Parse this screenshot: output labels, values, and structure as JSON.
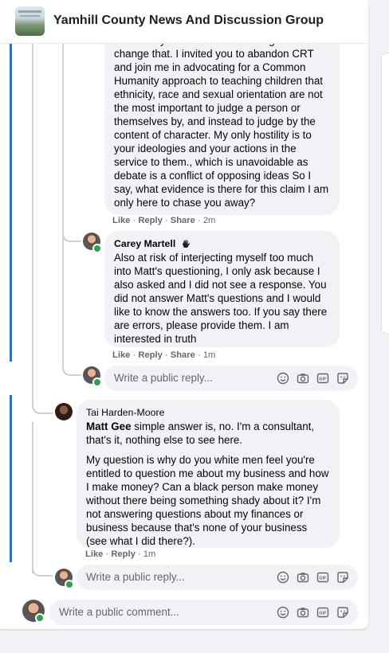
{
  "header": {
    "group_name": "Yamhill County News And Discussion Group"
  },
  "comment1": {
    "lines": [
      "community and no one has the right to",
      "change that. I invited you to abandon CRT",
      "and join me in advocating for a Common",
      "Humanity approach to teaching children that",
      "ethnicity, race and sexual orientation are not",
      "the most important to judge a person or",
      "themselves by, and instead to judge by the",
      "content of character. My only hostility is to",
      "your ideologies and your actions in the",
      "service to them., which is unavoidable as",
      "debate is a conflict of opposing ideas So I",
      "say, what evidence is there for this claim I am",
      "only here to chase you away?"
    ],
    "actions": {
      "like": "Like",
      "reply": "Reply",
      "share": "Share",
      "time": "2m"
    }
  },
  "comment2": {
    "author": "Carey Martell",
    "text": "Also at risk of interjecting myself too much into Matt's questioning, I only ask because I also asked and I did not see a response. You did not answer Matt's questions and I would like to know the answers too. If you say there are errors, please provide them. I am interested in truth",
    "actions": {
      "like": "Like",
      "reply": "Reply",
      "share": "Share",
      "time": "1m"
    }
  },
  "reply_box_1": {
    "placeholder": "Write a public reply..."
  },
  "comment3": {
    "author": "Tai Harden-Moore",
    "mention": "Matt Gee",
    "p1_rest": " simple answer is, no. I'm a consultant, that's it, nothing else to see here.",
    "p2": "My question is why do you white men feel you're entitled to question me about my business and how I make money? Can a black person make money without there being something shady about it? I'm not answering questions about my finances or business because that's none of your business (see what I did there?).",
    "actions": {
      "like": "Like",
      "reply": "Reply",
      "time": "1m"
    }
  },
  "reply_box_2": {
    "placeholder": "Write a public reply..."
  },
  "comment_box": {
    "placeholder": "Write a public comment..."
  },
  "icons": [
    "emoji-icon",
    "camera-icon",
    "gif-icon",
    "sticker-icon"
  ]
}
